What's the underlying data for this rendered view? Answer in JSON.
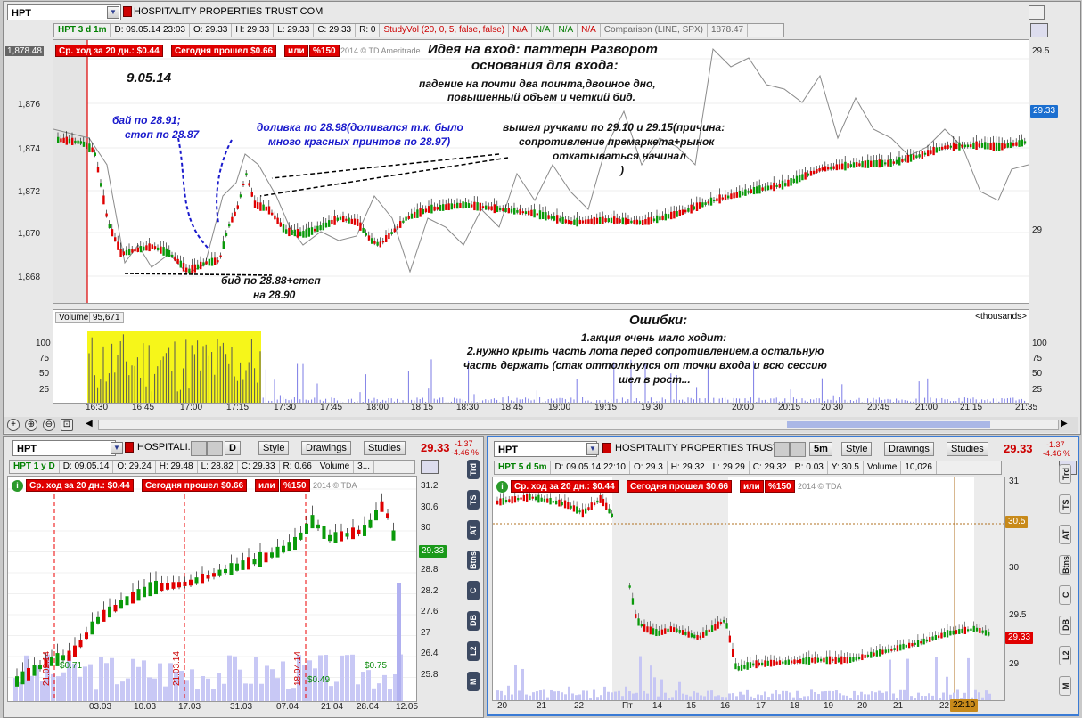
{
  "main": {
    "symbol_input": "HPT",
    "company": "HOSPITALITY PROPERTIES TRUST COM",
    "info": {
      "sym": "HPT 3 d 1m",
      "date": "D: 09.05.14 23:03",
      "open": "O: 29.33",
      "high": "H: 29.33",
      "low": "L: 29.33",
      "close": "C: 29.33",
      "range": "R: 0",
      "studyvol": "StudyVol (20, 0, 5, false, false)",
      "na1": "N/A",
      "na2": "N/A",
      "na3": "N/A",
      "na4": "N/A",
      "comparison": "Comparison (LINE, SPX)",
      "comparison_val": "1878.47"
    },
    "badges": {
      "avg_move": "Ср. ход за 20 дн.: $0.44",
      "today_move": "Сегодня прошел $0.66",
      "or": "или",
      "pct": "%150"
    },
    "copyright": "2014 © TD Ameritrade",
    "left_scale": [
      "1,878.48",
      "1,876",
      "1,874",
      "1,872",
      "1,870",
      "1,868"
    ],
    "right_scale": [
      "29.5",
      "29"
    ],
    "price_tag": "29.33",
    "volume_label": "Volume",
    "volume_value": "95,671",
    "thousands": "<thousands>",
    "volume_scale": [
      "100",
      "75",
      "50",
      "25"
    ],
    "x_ticks": [
      "16:30",
      "16:45",
      "17:00",
      "17:15",
      "17:30",
      "17:45",
      "18:00",
      "18:15",
      "18:30",
      "18:45",
      "19:00",
      "19:15",
      "19:30",
      "20:00",
      "20:15",
      "20:30",
      "20:45",
      "21:00",
      "21:15",
      "21:35"
    ],
    "notes": {
      "date": "9.05.14",
      "buy": "бай по 28.91;",
      "stop": "стоп по 28.87",
      "add1": "доливка по 28.98(доливался т.к. было",
      "add2": "много красных принтов по 28.97)",
      "idea1": "Идея на вход: паттерн Разворот",
      "idea2": "основания для входа:",
      "idea3": "падение на почти два поинта,двоиное дно,",
      "idea4": "повышенный объем и четкий бид.",
      "exit1": "вышел ручками по 29.10 и 29.15(причина:",
      "exit2": "сопротивление премаркета+рынок",
      "exit3": "откатываться начинал",
      "exit4": ")",
      "bid1": "бид по 28.88+степ",
      "bid2": "на 28.90",
      "err_title": "Ошибки:",
      "err1": "1.акция очень мало ходит:",
      "err2": "2.нужно крыть часть лота перед сопротивлением,а остальную",
      "err3": "часть держать (стак оттолкнулся от точки входа и всю сессию",
      "err4": "шел в рост..."
    }
  },
  "left": {
    "symbol_input": "HPT",
    "company": "HOSPITALI...",
    "period": "D",
    "style": "Style",
    "drawings": "Drawings",
    "studies": "Studies",
    "price": "29.33",
    "chg": "-1.37",
    "chg_pct": "-4.46 %",
    "info": {
      "sym": "HPT 1 y D",
      "date": "D: 09.05.14",
      "open": "O: 29.24",
      "high": "H: 29.48",
      "low": "L: 28.82",
      "close": "C: 29.33",
      "range": "R: 0.66",
      "vol": "Volume",
      "vol_val": "3..."
    },
    "scale": [
      "31.2",
      "30.6",
      "30",
      "29.4",
      "28.8",
      "28.2",
      "27.6",
      "27",
      "26.4",
      "25.8"
    ],
    "price_tag": "29.33",
    "x_ticks": [
      "03.03",
      "10.03",
      "17.03",
      "31.03",
      "07.04",
      "21.04",
      "28.04",
      "12.05"
    ],
    "dates_vert": [
      "21.02.14",
      "21.03.14",
      "18.04.14"
    ],
    "divs": [
      "$0.71",
      "$0.49",
      "$0.75"
    ],
    "copyright": "2014 © TDA"
  },
  "right": {
    "symbol_input": "HPT",
    "company": "HOSPITALITY PROPERTIES TRUST ...",
    "period": "5m",
    "style": "Style",
    "drawings": "Drawings",
    "studies": "Studies",
    "price": "29.33",
    "chg": "-1.37",
    "chg_pct": "-4.46 %",
    "info": {
      "sym": "HPT 5 d 5m",
      "date": "D: 09.05.14 22:10",
      "open": "O: 29.3",
      "high": "H: 29.32",
      "low": "L: 29.29",
      "close": "C: 29.32",
      "range": "R: 0.03",
      "y": "Y: 30.5",
      "vol": "Volume",
      "vol_val": "10,026"
    },
    "scale": [
      "31",
      "30.5",
      "30",
      "29.5",
      "29"
    ],
    "price_tag": "29.33",
    "level_tag": "30.5",
    "time_tag": "22:10",
    "x_ticks": [
      "20",
      "21",
      "22",
      "Пт",
      "14",
      "15",
      "16",
      "17",
      "18",
      "19",
      "20",
      "21",
      "22",
      "23"
    ],
    "copyright": "2014 © TDA",
    "side_buttons": [
      "Trd",
      "TS",
      "AT",
      "Btns",
      "C",
      "DB",
      "L2",
      "M"
    ]
  },
  "left_side_buttons": [
    "Trd",
    "TS",
    "AT",
    "Btns",
    "C",
    "DB",
    "L2",
    "M"
  ]
}
